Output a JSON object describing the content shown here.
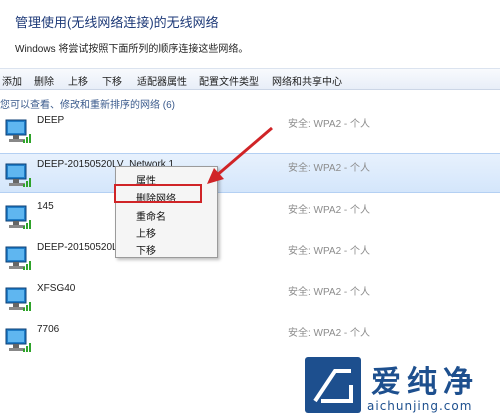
{
  "header": {
    "title": "管理使用(无线网络连接)的无线网络",
    "subtitle": "Windows 将尝试按照下面所列的顺序连接这些网络。"
  },
  "toolbar": {
    "items": [
      "添加",
      "删除",
      "上移",
      "下移",
      "适配器属性",
      "配置文件类型",
      "网络和共享中心"
    ]
  },
  "info_text": "您可以查看、修改和重新排序的网络 (6)",
  "networks": [
    {
      "name": "DEEP",
      "security": "安全: WPA2 - 个人"
    },
    {
      "name": "DEEP-20150520LV_Network 1",
      "security": "安全: WPA2 - 个人"
    },
    {
      "name": "145",
      "security": "安全: WPA2 - 个人"
    },
    {
      "name": "DEEP-20150520LV",
      "security": "安全: WPA2 - 个人"
    },
    {
      "name": "XFSG40",
      "security": "安全: WPA2 - 个人"
    },
    {
      "name": "7706",
      "security": "安全: WPA2 - 个人"
    }
  ],
  "context_menu": {
    "items": [
      "属性",
      "删除网络",
      "重命名",
      "上移",
      "下移"
    ]
  },
  "watermark": {
    "brand": "爱纯净",
    "url": "aichunjing.com"
  },
  "colors": {
    "title": "#1e3a78",
    "selection": "#d4e6fb",
    "highlight_box": "#d02427",
    "arrow": "#d02427",
    "brand": "#1d4f8e"
  }
}
